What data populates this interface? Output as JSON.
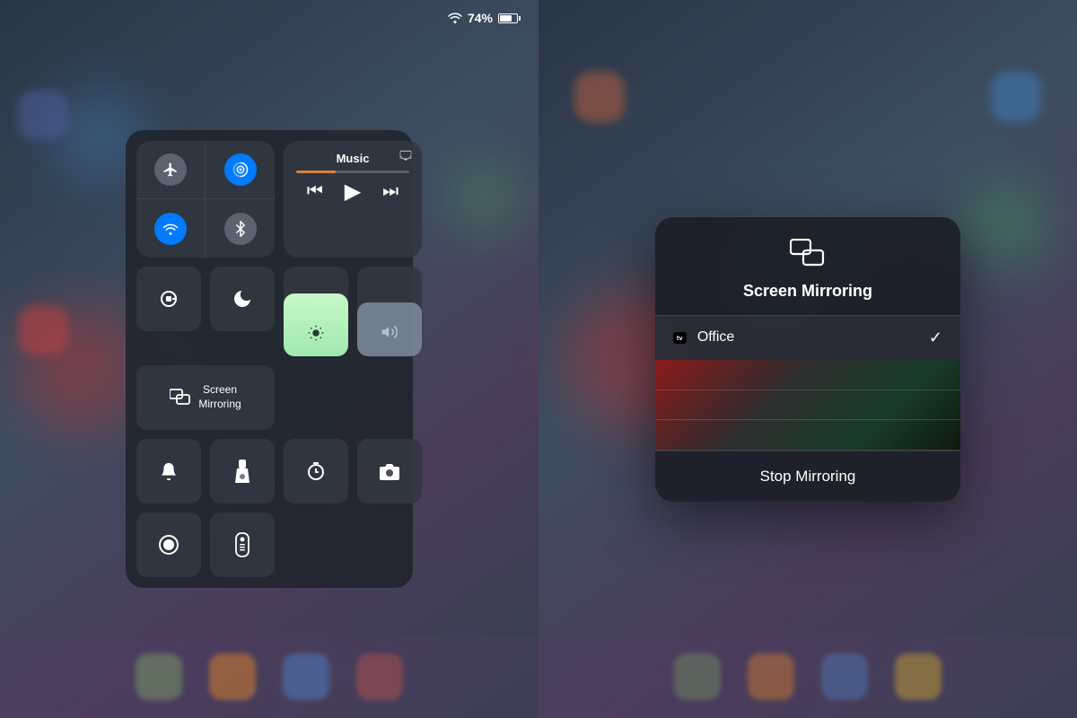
{
  "statusBar": {
    "batteryPercent": "74%",
    "wifiLabel": "wifi"
  },
  "leftPanel": {
    "connectivity": {
      "airplaneMode": {
        "label": "airplane-mode",
        "active": false,
        "icon": "✈"
      },
      "cellularData": {
        "label": "cellular-data",
        "active": true,
        "icon": "⚡"
      },
      "wifi": {
        "label": "wifi",
        "active": true,
        "icon": "📶"
      },
      "bluetooth": {
        "label": "bluetooth",
        "active": false,
        "icon": "⚡"
      }
    },
    "music": {
      "title": "Music",
      "airplayIcon": "airplay",
      "progress": 35
    },
    "controls": {
      "rotation": {
        "label": "rotation-lock",
        "icon": "🔄"
      },
      "doNotDisturb": {
        "label": "do-not-disturb",
        "icon": "🌙"
      },
      "screenMirroring": {
        "label": "Screen Mirroring"
      },
      "brightness": {
        "label": "brightness",
        "level": 70
      },
      "volume": {
        "label": "volume",
        "level": 60
      },
      "bell": {
        "label": "bell",
        "icon": "🔔"
      },
      "flashlight": {
        "label": "flashlight",
        "icon": "🔦"
      },
      "timer": {
        "label": "timer",
        "icon": "⏱"
      },
      "camera": {
        "label": "camera",
        "icon": "📷"
      },
      "record": {
        "label": "screen-record",
        "icon": "⏺"
      },
      "remote": {
        "label": "apple-tv-remote",
        "icon": "📱"
      }
    }
  },
  "rightPanel": {
    "screenMirroringDialog": {
      "title": "Screen Mirroring",
      "device": {
        "name": "Office",
        "type": "Apple TV",
        "badge": "tv",
        "selected": true
      },
      "stopMirroringLabel": "Stop Mirroring"
    }
  },
  "background": {
    "leftBlobColor1": "#e84040",
    "leftBlobColor2": "#4080c0",
    "rightBlobColor1": "#e84040",
    "rightBlobColor2": "#40c060"
  }
}
